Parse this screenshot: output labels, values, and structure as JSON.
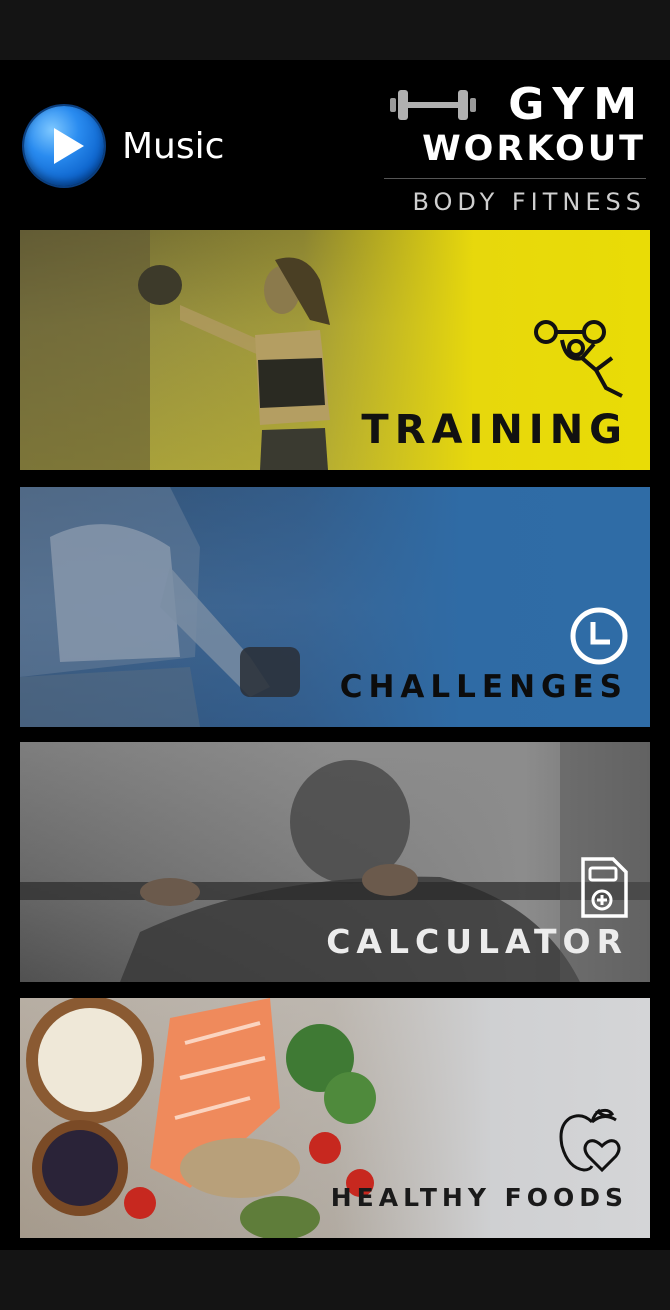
{
  "header": {
    "music_label": "Music",
    "logo": {
      "line1": "GYM",
      "line2": "WORKOUT",
      "subtitle": "BODY FITNESS"
    }
  },
  "cards": [
    {
      "label": "TRAINING",
      "icon": "weightlifter-icon"
    },
    {
      "label": "CHALLENGES",
      "icon": "clock-icon"
    },
    {
      "label": "CALCULATOR",
      "icon": "calculator-icon"
    },
    {
      "label": "HEALTHY FOODS",
      "icon": "apple-heart-icon"
    }
  ],
  "colors": {
    "training": "#e9dc06",
    "challenges": "#2f6ca6",
    "calculator": "#8c8c8c",
    "healthy_foods": "#d4d5d7"
  }
}
